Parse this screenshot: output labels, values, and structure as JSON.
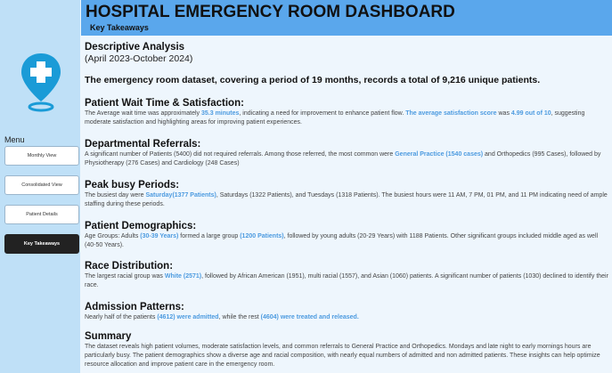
{
  "header": {
    "title": "HOSPITAL EMERGENCY ROOM DASHBOARD",
    "subtitle": "Key Takeaways"
  },
  "sidebar": {
    "menu_label": "Menu",
    "items": [
      {
        "label": "Monthly View"
      },
      {
        "label": "Consolidated View"
      },
      {
        "label": "Patient Details"
      },
      {
        "label": "Key Takeaways"
      }
    ]
  },
  "colors": {
    "header": "#5aa7ec",
    "sidebar": "#bfe0f7",
    "highlight": "#4d9be0",
    "logo": "#1a9bd7"
  },
  "icons": {
    "logo": "location-pin-cross-icon"
  },
  "intro": {
    "heading": "Descriptive Analysis",
    "period": "(April 2023-October 2024)",
    "summary": "The emergency room dataset, covering a period of 19 months, records a total of 9,216 unique patients."
  },
  "sections": {
    "wait": {
      "heading": "Patient Wait Time & Satisfaction:",
      "t1": "The Average wait time was approximately ",
      "h1": "35.3 minutes",
      "t2": ", indicating a need for improvement to enhance patient flow. ",
      "h2": "The average satisfaction score",
      "t3": " was ",
      "h3": "4.99 out of 10",
      "t4": ", suggesting moderate satisfaction and highlighting areas for improving patient experiences."
    },
    "referrals": {
      "heading": "Departmental Referrals:",
      "t1": "A significant number of Patients (5400) did not required referrals. Among those referred, the most common were ",
      "h1": "General Practice (1540 cases)",
      "t2": " and Orthopedics (995 Cases), followed by Physiotherapy (276 Cases) and Cardiology (248 Cases)"
    },
    "peak": {
      "heading": "Peak busy Periods:",
      "t1": "The busiest day were ",
      "h1": "Saturday(1377 Patients)",
      "t2": ", Saturdays (1322 Patients), and Tuesdays (1318 Patients). The busiest hours were 11 AM, 7 PM, 01 PM, and 11 PM indicating need of ample staffing during these periods."
    },
    "demographics": {
      "heading": "Patient Demographics:",
      "t1": "Age Groups: Adults ",
      "h1": "(30-39 Years)",
      "t2": " formed a large group ",
      "h2": "(1200 Patients)",
      "t3": ", followed by young adults (20-29 Years) with 1188 Patients. Other significant groups included middle aged as well (40-50 Years)."
    },
    "race": {
      "heading": "Race Distribution:",
      "t1": "The largest racial group was ",
      "h1": "White (2571)",
      "t2": ", followed by African American (1951), multi racial (1557), and Asian (1060) patients. A significant number of patients (1030) declined to identify their race."
    },
    "admission": {
      "heading": "Admission Patterns:",
      "t1": "Nearly half of the patients ",
      "h1": "(4612) were admitted",
      "t2": ", while the rest ",
      "h2": "(4604) were treated and released."
    },
    "summary": {
      "heading": "Summary",
      "text": "The dataset reveals high patient volumes, moderate satisfaction levels, and common referrals to General Practice and Orthopedics. Mondays and late night to early mornings hours are particularly busy. The patient demographics show a diverse age and racial composition, with nearly equal numbers of admitted and non admitted patients. These insights can help optimize resource allocation and improve patient care in the emergency room."
    }
  }
}
